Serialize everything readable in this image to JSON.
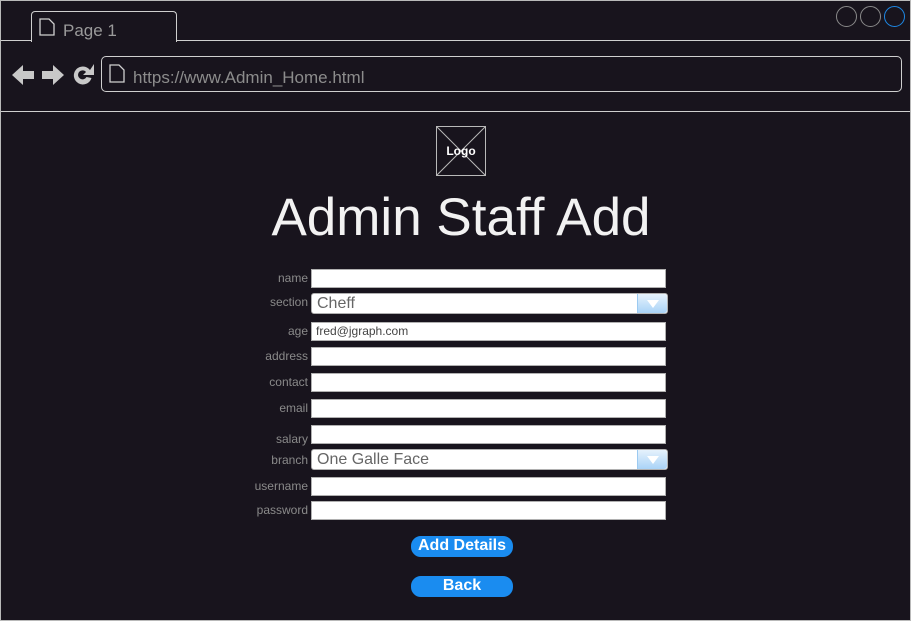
{
  "browser": {
    "tab_label": "Page 1",
    "url": "https://www.Admin_Home.html"
  },
  "logo": {
    "label": "Logo"
  },
  "page": {
    "title": "Admin Staff Add"
  },
  "form": {
    "name": {
      "label": "name",
      "value": ""
    },
    "section": {
      "label": "section",
      "value": "Cheff"
    },
    "age": {
      "label": "age",
      "value": "fred@jgraph.com"
    },
    "address": {
      "label": "address",
      "value": ""
    },
    "contact": {
      "label": "contact",
      "value": ""
    },
    "email": {
      "label": "email",
      "value": ""
    },
    "salary": {
      "label": "salary",
      "value": ""
    },
    "branch": {
      "label": "branch",
      "value": "One Galle Face"
    },
    "username": {
      "label": "username",
      "value": ""
    },
    "password": {
      "label": "password",
      "value": ""
    }
  },
  "buttons": {
    "add_details": "Add Details",
    "back": "Back"
  },
  "colors": {
    "background": "#18141d",
    "accent": "#1a8cf0"
  }
}
